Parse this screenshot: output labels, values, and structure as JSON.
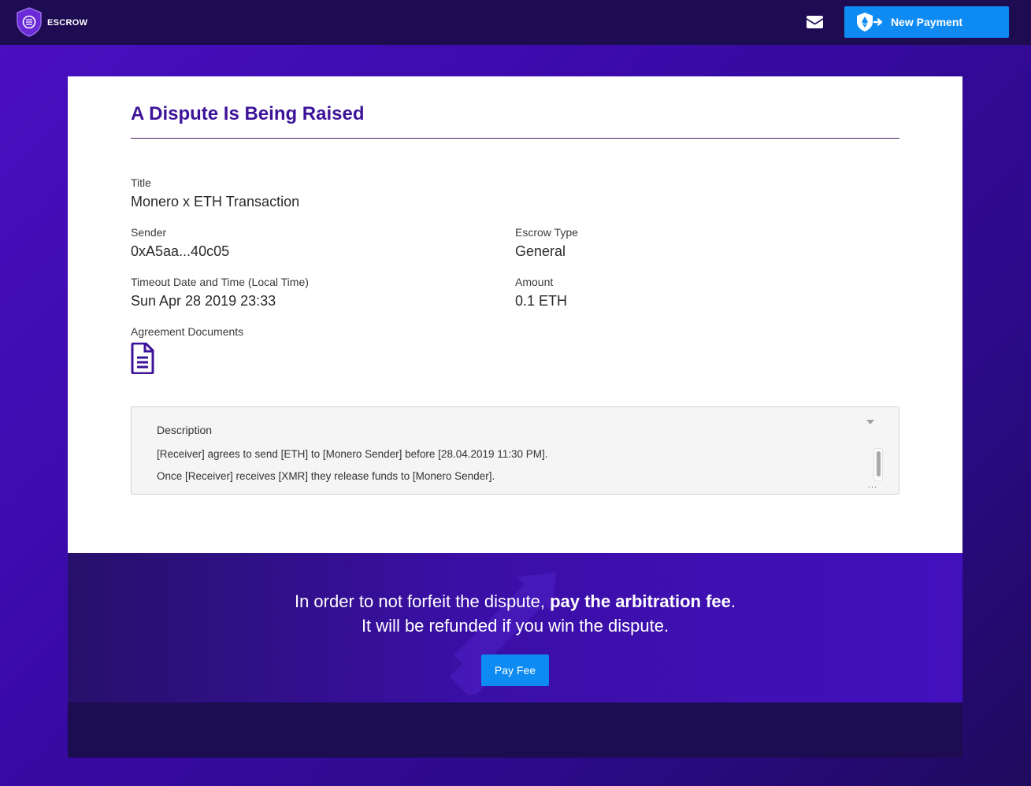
{
  "header": {
    "logo_text": "ESCROW",
    "mail_icon": "envelope-icon",
    "new_payment_label": "New Payment",
    "new_payment_icon": "shield-ethereum-arrow-icon",
    "accent_color": "#0d8bf2"
  },
  "dispute": {
    "title": "A Dispute Is Being Raised",
    "fields": {
      "title_label": "Title",
      "title_value": "Monero x ETH Transaction",
      "sender_label": "Sender",
      "sender_value": "0xA5aa...40c05",
      "escrow_type_label": "Escrow Type",
      "escrow_type_value": "General",
      "timeout_label": "Timeout Date and Time (Local Time)",
      "timeout_value": "Sun Apr 28 2019 23:33",
      "amount_label": "Amount",
      "amount_value": "0.1 ETH",
      "documents_label": "Agreement Documents"
    },
    "description": {
      "label": "Description",
      "lines": [
        "[Receiver] agrees to send [ETH] to [Monero Sender] before [28.04.2019 11:30 PM].",
        "Once [Receiver] receives [XMR] they release funds to [Monero Sender]."
      ],
      "overflow_marker": "..."
    }
  },
  "footer": {
    "line1_prefix": "In order to not forfeit the dispute, ",
    "line1_bold": "pay the arbitration fee",
    "line1_suffix": ".",
    "line2": "It will be refunded if you win the dispute.",
    "pay_fee_label": "Pay Fee"
  }
}
